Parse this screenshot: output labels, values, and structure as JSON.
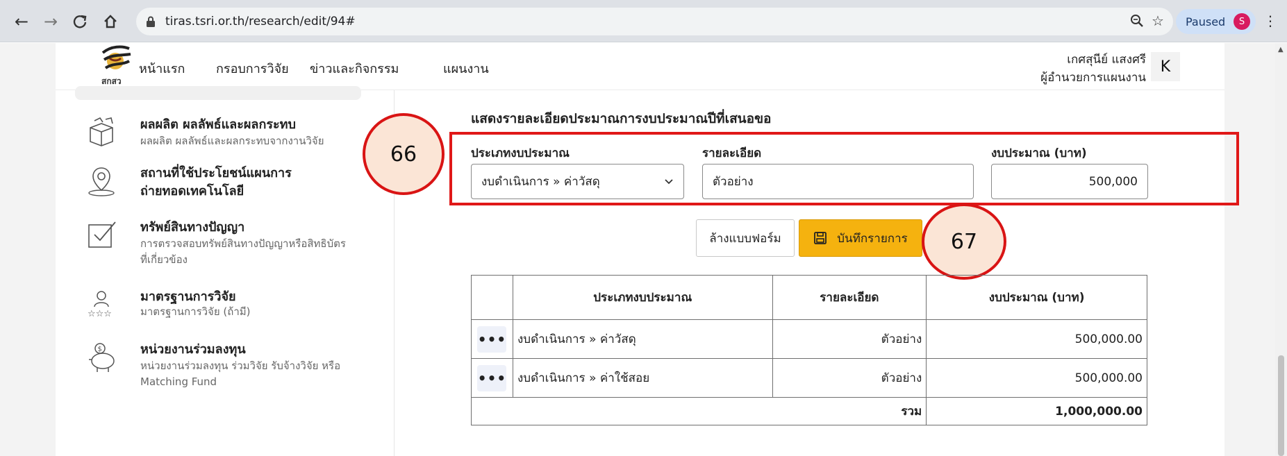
{
  "browser": {
    "url": "tiras.tsri.or.th/research/edit/94#",
    "paused_label": "Paused",
    "profile_initial": "S"
  },
  "header": {
    "logo_text": "สกสว",
    "menu": [
      "หน้าแรก",
      "กรอบการวิจัย",
      "ข่าวและกิจกรรม",
      "แผนงาน"
    ],
    "user_name": "เกศสุนีย์ แสงศรี",
    "user_role": "ผู้อำนวยการแผนงาน",
    "avatar_initial": "K"
  },
  "sidebar": {
    "items": [
      {
        "title": "ผลผลิต ผลลัพธ์และผลกระทบ",
        "desc": "ผลผลิต ผลลัพธ์และผลกระทบจากงานวิจัย"
      },
      {
        "title": "สถานที่ใช้ประโยชน์แผนการถ่ายทอดเทคโนโลยี",
        "title_line1": "สถานที่ใช้ประโยชน์แผนการ",
        "title_line2": "ถ่ายทอดเทคโนโลยี",
        "desc": ""
      },
      {
        "title": "ทรัพย์สินทางปัญญา",
        "desc": "การตรวจสอบทรัพย์สินทางปัญญาหรือสิทธิบัตรที่เกี่ยวข้อง"
      },
      {
        "title": "มาตรฐานการวิจัย",
        "desc": "มาตรฐานการวิจัย (ถ้ามี)"
      },
      {
        "title": "หน่วยงานร่วมลงทุน",
        "desc": "หน่วยงานร่วมลงทุน ร่วมวิจัย รับจ้างวิจัย หรือ Matching Fund"
      }
    ]
  },
  "form": {
    "section_title": "แสดงรายละเอียดประมาณการงบประมาณปีที่เสนอขอ",
    "budget_type_label": "ประเภทงบประมาณ",
    "budget_type_value": "งบดำเนินการ » ค่าวัสดุ",
    "detail_label": "รายละเอียด",
    "detail_value": "ตัวอย่าง",
    "amount_label": "งบประมาณ (บาท)",
    "amount_value": "500,000",
    "clear_button": "ล้างแบบฟอร์ม",
    "save_button": "บันทึกรายการ"
  },
  "callouts": {
    "first": "66",
    "second": "67"
  },
  "table": {
    "headers": [
      "ประเภทงบประมาณ",
      "รายละเอียด",
      "งบประมาณ (บาท)"
    ],
    "rows": [
      {
        "action": "•••",
        "type": "งบดำเนินการ » ค่าวัสดุ",
        "detail": "ตัวอย่าง",
        "amount": "500,000.00"
      },
      {
        "action": "•••",
        "type": "งบดำเนินการ » ค่าใช้สอย",
        "detail": "ตัวอย่าง",
        "amount": "500,000.00"
      }
    ],
    "total_label": "รวม",
    "total_amount": "1,000,000.00"
  },
  "colors": {
    "accent": "#f5b20f",
    "highlight_red": "#e01818",
    "callout_fill": "#fbe5d6"
  }
}
